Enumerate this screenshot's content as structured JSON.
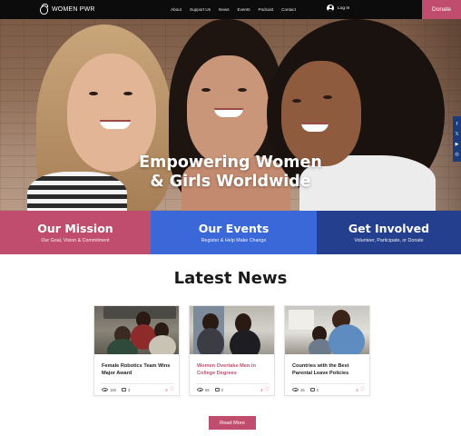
{
  "header": {
    "logo_text": "WOMEN PWR",
    "nav": [
      "About",
      "Support Us",
      "News",
      "Events",
      "Podcast",
      "Contact"
    ],
    "login_label": "Log In",
    "donate_label": "Donate"
  },
  "hero": {
    "title_line1": "Empowering Women",
    "title_line2": "& Girls Worldwide",
    "social": [
      "f",
      "𝕏",
      "▶",
      "◎"
    ]
  },
  "blocks": [
    {
      "title": "Our Mission",
      "subtitle": "Our Goal, Vision & Commitment"
    },
    {
      "title": "Our Events",
      "subtitle": "Register & Help Make Change"
    },
    {
      "title": "Get Involved",
      "subtitle": "Volunteer, Participate, or Donate"
    }
  ],
  "news": {
    "heading": "Latest News",
    "read_more_label": "Read More",
    "cards": [
      {
        "title": "Female Robotics Team Wins Major Award",
        "views": "150",
        "comments": "3",
        "likes": "3"
      },
      {
        "title": "Women Overtake Men in College Degrees",
        "views": "56",
        "comments": "0",
        "likes": "4"
      },
      {
        "title": "Countries with the Best Parental Leave Policies",
        "views": "45",
        "comments": "3",
        "likes": "3"
      }
    ]
  },
  "colors": {
    "pink": "#c14d6e",
    "blue": "#3a68d8",
    "navy": "#233f8e",
    "topbar": "#0c0c0c"
  }
}
